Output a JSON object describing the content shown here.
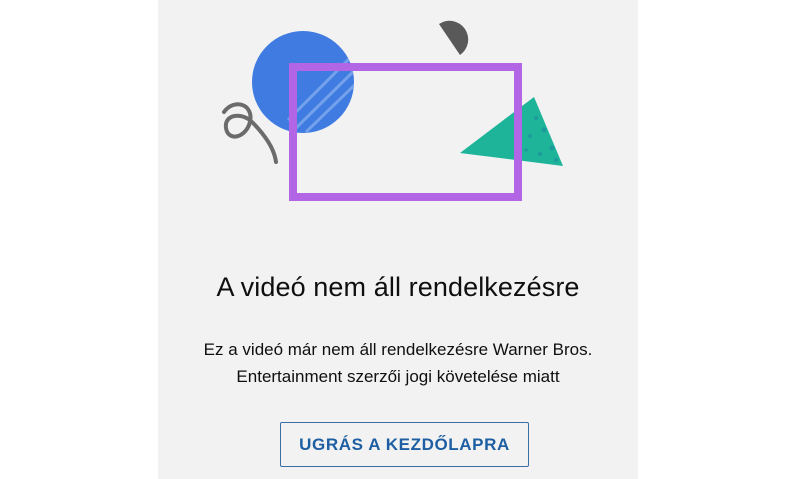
{
  "error": {
    "title": "A videó nem áll rendelkezésre",
    "message_line1": "Ez a videó már nem áll rendelkezésre Warner Bros.",
    "message_line2": "Entertainment szerzői jogi követelése miatt",
    "button_label": "UGRÁS A KEZDŐLAPRA"
  },
  "colors": {
    "panel_background": "#f2f2f2",
    "circle": "#3f7be0",
    "frame": "#b266e6",
    "triangle": "#1db49a",
    "button_border": "#3b6da6",
    "button_text": "#1e5fa3"
  },
  "icons": [
    "blue-circle-shape",
    "purple-frame-shape",
    "teal-triangle-shape",
    "gray-half-circle-shape",
    "gray-squiggle-shape"
  ]
}
